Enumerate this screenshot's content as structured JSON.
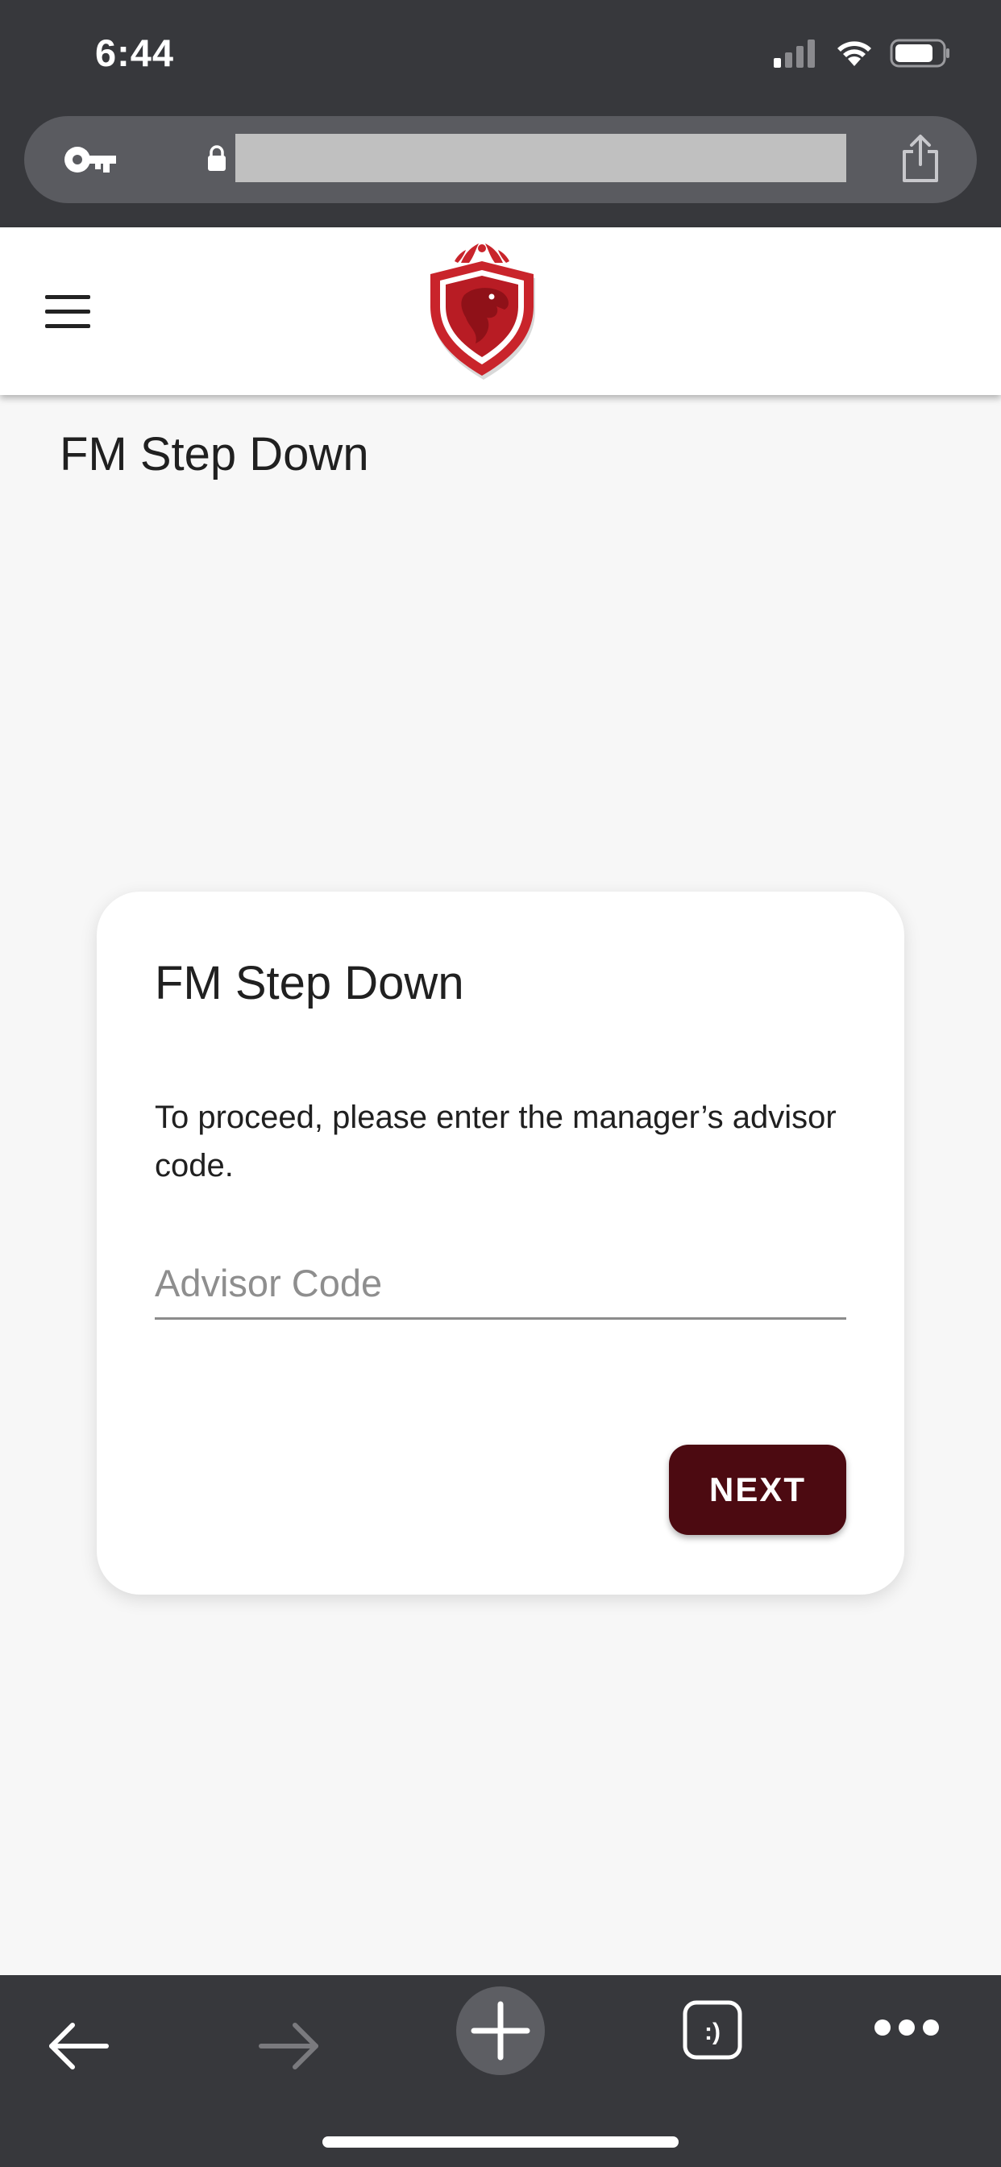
{
  "status_bar": {
    "time": "6:44"
  },
  "browser": {
    "url": "",
    "icons": [
      "key-icon",
      "lock-icon",
      "share-icon"
    ]
  },
  "header": {
    "menu_icon": "hamburger-menu-icon",
    "logo": "shield-eagle-logo"
  },
  "page": {
    "title": "FM Step Down"
  },
  "card": {
    "title": "FM Step Down",
    "instruction": "To proceed, please enter the manager’s advisor code.",
    "advisor_code": {
      "value": "",
      "placeholder": "Advisor Code"
    },
    "next_label": "NEXT"
  },
  "toolbar": {
    "icons": [
      "back-arrow-icon",
      "forward-arrow-icon",
      "new-tab-plus-icon",
      "tabs-icon",
      "more-icon"
    ],
    "tabs_label": ":)"
  },
  "colors": {
    "chrome": "#37383c",
    "url_bar": "#5a5b60",
    "button": "#4c0a11",
    "logo_red": "#c9242b",
    "background": "#f7f7f7"
  }
}
